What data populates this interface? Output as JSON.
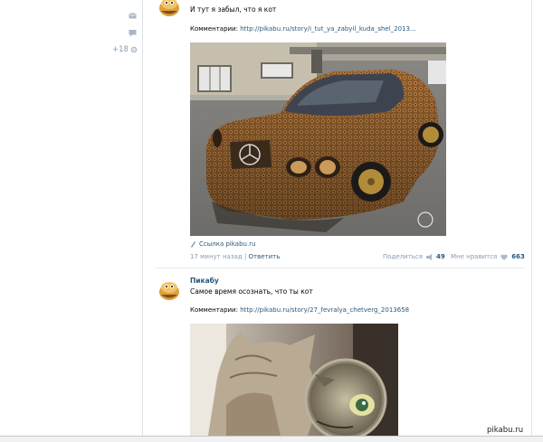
{
  "sidebar": {
    "counter": "+18"
  },
  "posts": [
    {
      "author": "",
      "text": "И тут я забыл, что я кот",
      "comments_label": "Комментарии:",
      "comments_url": "http://pikabu.ru/story/i_tut_ya_zabyil_kuda_shel_2013...",
      "link_label": "Ссылка pikabu.ru",
      "time": "17 минут назад",
      "reply_label": "Ответить",
      "share_label": "Поделиться",
      "share_count": "49",
      "like_label": "Мне нравится",
      "like_count": "663"
    },
    {
      "author": "Пикабу",
      "text": "Самое время осознать, что ты кот",
      "comments_label": "Комментарии:",
      "comments_url": "http://pikabu.ru/story/27_fevralya_chetverg_2013658"
    }
  ],
  "watermark": "pikabu.ru",
  "colors": {
    "link": "#2b587a",
    "muted": "#8a9bb0",
    "divider": "#e7ebf0"
  }
}
